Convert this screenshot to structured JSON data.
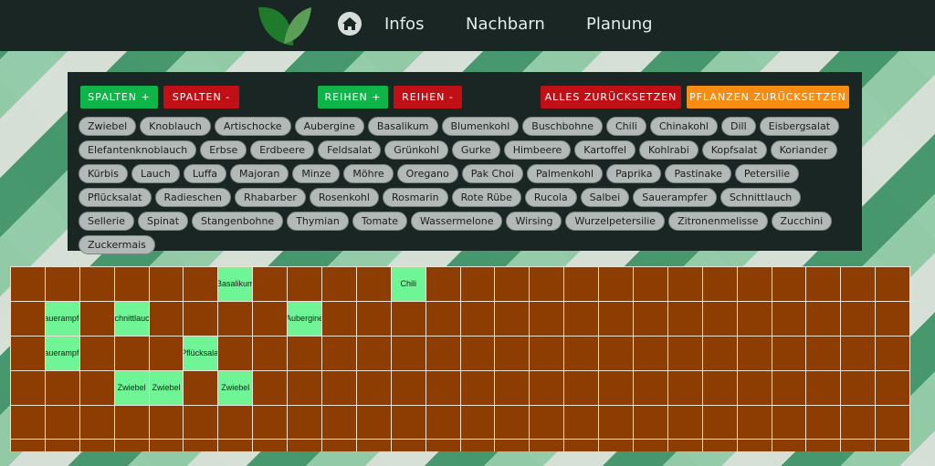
{
  "nav": {
    "links": [
      "Infos",
      "Nachbarn",
      "Planung"
    ]
  },
  "controls": {
    "spalten_plus": "SPALTEN +",
    "spalten_minus": "SPALTEN -",
    "reihen_plus": "REIHEN +",
    "reihen_minus": "REIHEN -",
    "reset_all": "ALLES ZURÜCKSETZEN",
    "reset_plants": "PFLANZEN ZURÜCKSETZEN"
  },
  "plants": [
    "Zwiebel",
    "Knoblauch",
    "Artischocke",
    "Aubergine",
    "Basalikum",
    "Blumenkohl",
    "Buschbohne",
    "Chili",
    "Chinakohl",
    "Dill",
    "Eisbergsalat",
    "Elefantenknoblauch",
    "Erbse",
    "Erdbeere",
    "Feldsalat",
    "Grünkohl",
    "Gurke",
    "Himbeere",
    "Kartoffel",
    "Kohlrabi",
    "Kopfsalat",
    "Koriander",
    "Kürbis",
    "Lauch",
    "Luffa",
    "Majoran",
    "Minze",
    "Möhre",
    "Oregano",
    "Pak Choi",
    "Palmenkohl",
    "Paprika",
    "Pastinake",
    "Petersilie",
    "Pflücksalat",
    "Radieschen",
    "Rhabarber",
    "Rosenkohl",
    "Rosmarin",
    "Rote Rübe",
    "Rucola",
    "Salbei",
    "Sauerampfer",
    "Schnittlauch",
    "Sellerie",
    "Spinat",
    "Stangenbohne",
    "Thymian",
    "Tomate",
    "Wassermelone",
    "Wirsing",
    "Wurzelpetersilie",
    "Zitronenmelisse",
    "Zucchini",
    "Zuckermais"
  ],
  "bed": {
    "columns": 26,
    "rows": 6,
    "planted": [
      {
        "row": 0,
        "col": 6,
        "label": "Basalikum"
      },
      {
        "row": 0,
        "col": 11,
        "label": "Chili"
      },
      {
        "row": 1,
        "col": 1,
        "label": "Sauerampfer"
      },
      {
        "row": 1,
        "col": 3,
        "label": "Schnittlauch"
      },
      {
        "row": 1,
        "col": 8,
        "label": "Aubergine"
      },
      {
        "row": 2,
        "col": 1,
        "label": "Sauerampfer"
      },
      {
        "row": 2,
        "col": 5,
        "label": "Pflücksalat"
      },
      {
        "row": 3,
        "col": 3,
        "label": "Zwiebel"
      },
      {
        "row": 3,
        "col": 4,
        "label": "Zwiebel"
      },
      {
        "row": 3,
        "col": 6,
        "label": "Zwiebel"
      }
    ]
  },
  "colors": {
    "bed_empty": "#8e3d02",
    "bed_planted": "#6ff595",
    "button_green": "#10b549",
    "button_red": "#c10f16",
    "button_orange": "#f78c12",
    "panel": "#192624"
  }
}
